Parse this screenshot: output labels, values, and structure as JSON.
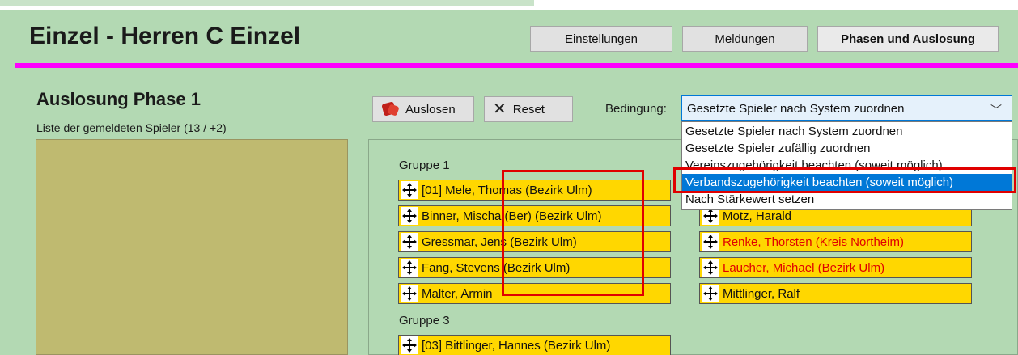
{
  "header": {
    "title": "Einzel - Herren C Einzel",
    "buttons": {
      "settings": "Einstellungen",
      "registrations": "Meldungen",
      "phases": "Phasen und Auslosung"
    }
  },
  "left": {
    "phase_title": "Auslosung Phase 1",
    "player_count": "Liste der gemeldeten Spieler (13 / +2)"
  },
  "toolbar": {
    "draw": "Auslosen",
    "reset": "Reset",
    "condition_label": "Bedingung:",
    "condition_value": "Gesetzte Spieler nach System zuordnen",
    "options": [
      "Gesetzte Spieler nach System zuordnen",
      "Gesetzte Spieler zufällig zuordnen",
      "Vereinszugehörigkeit beachten (soweit möglich)",
      "Verbandszugehörigkeit beachten (soweit möglich)",
      "Nach Stärkewert setzen"
    ],
    "selected_option_index": 3
  },
  "groups": {
    "g1": {
      "label": "Gruppe 1",
      "players": [
        "[01] Mele, Thomas (Bezirk Ulm)",
        "Binner, Mischa (Ber) (Bezirk Ulm)",
        "Gressmar, Jens (Bezirk Ulm)",
        "Fang, Stevens (Bezirk Ulm)",
        "Malter, Armin"
      ]
    },
    "g2": {
      "players": [
        "Motz, Harald",
        "Renke, Thorsten (Kreis Northeim)",
        "Laucher, Michael (Bezirk Ulm)",
        "Mittlinger, Ralf"
      ]
    },
    "g3": {
      "label": "Gruppe 3",
      "players": [
        "[03] Bittlinger, Hannes (Bezirk Ulm)"
      ]
    }
  },
  "colors": {
    "background": "#b3d9b3",
    "accent_line": "#ff00ff",
    "player_card": "#ffd700",
    "warning_text": "#e00000",
    "selection": "#0078d7"
  }
}
